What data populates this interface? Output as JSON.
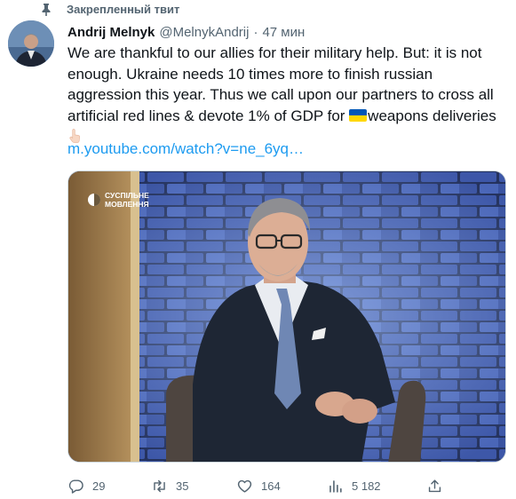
{
  "pinned_label": "Закрепленный твит",
  "author": {
    "name": "Andrij Melnyk",
    "handle": "@MelnykAndrij",
    "separator": "·",
    "time": "47 мин"
  },
  "tweet": {
    "text_before_flag": "We are thankful to our allies for their military help. But: it is not enough. Ukraine needs 10 times more to finish russian aggression this year. Thus we call upon our partners to cross all artificial red lines & devote 1% of GDP for ",
    "text_after_flag": "weapons deliveries",
    "link": "m.youtube.com/watch?v=ne_6yq…"
  },
  "media": {
    "watermark_line1": "СУСПІЛЬНЕ",
    "watermark_line2": "МОВЛЕННЯ"
  },
  "actions": {
    "replies": "29",
    "retweets": "35",
    "likes": "164",
    "views": "5 182"
  },
  "colors": {
    "text": "#0f1419",
    "secondary": "#536471",
    "link": "#1d9bf0",
    "flag_blue": "#0057b7",
    "flag_yellow": "#ffd700"
  },
  "icons": [
    "pin-icon",
    "reply-icon",
    "retweet-icon",
    "like-icon",
    "views-icon",
    "share-icon"
  ]
}
